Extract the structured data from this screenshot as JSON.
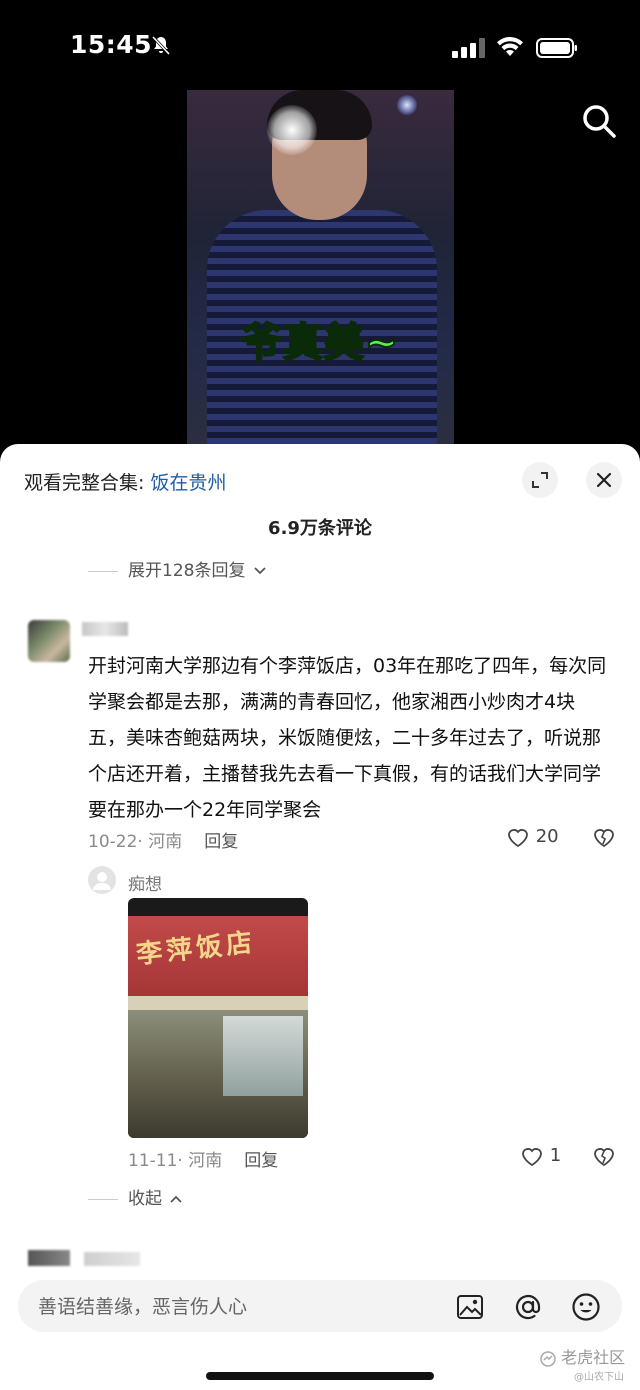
{
  "status_bar": {
    "time": "15:45"
  },
  "video": {
    "caption": "爷真美~"
  },
  "collection": {
    "label": "观看完整合集: ",
    "name": "饭在贵州"
  },
  "comments": {
    "count_label": "6.9万条评论",
    "expand_label": "展开128条回复",
    "main": {
      "text": "开封河南大学那边有个李萍饭店，03年在那吃了四年，每次同学聚会都是去那，满满的青春回忆，他家湘西小炒肉才4块五，美味杏鲍菇两块，米饭随便炫，二十多年过去了，听说那个店还开着，主播替我先去看一下真假，有的话我们大学同学要在那办一个22年同学聚会",
      "date_location": "10-22· 河南",
      "reply_label": "回复",
      "likes": "20"
    },
    "sub": {
      "username": "痴想",
      "photo_sign": "李萍饭店",
      "date_location": "11-11· 河南",
      "reply_label": "回复",
      "likes": "1"
    },
    "collapse_label": "收起"
  },
  "input": {
    "placeholder": "善语结善缘，恶言伤人心"
  },
  "watermark": {
    "main": "老虎社区",
    "sub": "@山农下山"
  }
}
